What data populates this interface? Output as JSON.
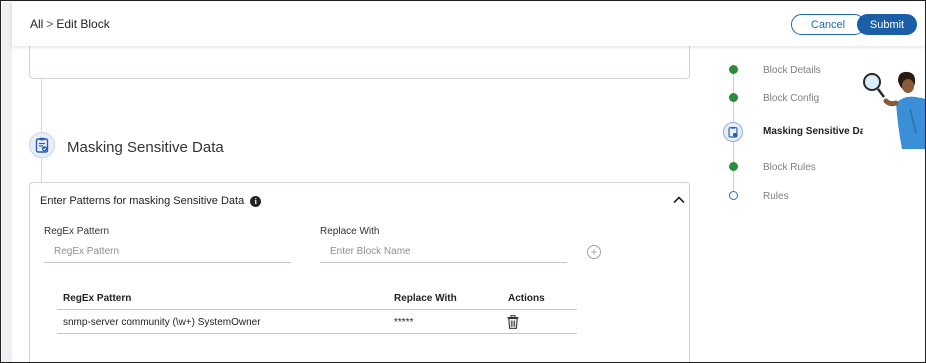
{
  "header": {
    "breadcrumb_root": "All",
    "breadcrumb_sep": ">",
    "breadcrumb_current": "Edit Block",
    "cancel_label": "Cancel",
    "submit_label": "Submit"
  },
  "section": {
    "title": "Masking Sensitive Data",
    "card_title": "Enter Patterns for masking Sensitive Data",
    "regex_label": "RegEx Pattern",
    "regex_placeholder": "RegEx Pattern",
    "replace_label": "Replace With",
    "replace_placeholder": "Enter Block Name"
  },
  "table": {
    "headers": [
      "RegEx Pattern",
      "Replace With",
      "Actions"
    ],
    "rows": [
      {
        "pattern": "snmp-server community (\\w+) SystemOwner",
        "replace": "*****"
      }
    ]
  },
  "steps": [
    {
      "label": "Block Details",
      "state": "done"
    },
    {
      "label": "Block Config",
      "state": "done"
    },
    {
      "label": "Masking Sensitive Da",
      "state": "active"
    },
    {
      "label": "Block Rules",
      "state": "done"
    },
    {
      "label": "Rules",
      "state": "todo"
    }
  ],
  "colors": {
    "primary": "#1a5fa8",
    "done": "#2e8b3a",
    "border": "#cfd3d8"
  }
}
